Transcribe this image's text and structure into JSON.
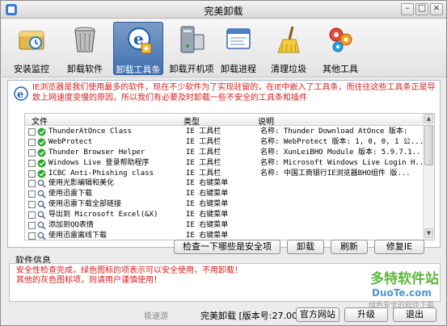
{
  "window": {
    "title": "完美卸载",
    "controls": [
      "minimize-icon",
      "maximize-icon",
      "close-icon"
    ]
  },
  "toolbar": {
    "tools": [
      {
        "label": "安装监控",
        "icon": "install-monitor-icon",
        "selected": false
      },
      {
        "label": "卸载软件",
        "icon": "trash-bin-icon",
        "selected": false
      },
      {
        "label": "卸载工具条",
        "icon": "ie-toolbar-icon",
        "selected": true
      },
      {
        "label": "卸载开机项",
        "icon": "computer-startup-icon",
        "selected": false
      },
      {
        "label": "卸载进程",
        "icon": "process-window-icon",
        "selected": false
      },
      {
        "label": "清理垃圾",
        "icon": "broom-icon",
        "selected": false
      },
      {
        "label": "其他工具",
        "icon": "gears-icon",
        "selected": false
      }
    ]
  },
  "notice": {
    "text": "IE浏览器是我们使用最多的软件，现在不少软件为了实现驻留的，在IE中嵌入了工具条，而往往这些工具条正是导致上网速度变慢的原因，所以我们有必要及时卸载一些不安全的工具条和插件"
  },
  "list": {
    "headers": {
      "file": "文件",
      "type": "类型",
      "desc": "说明"
    },
    "rows": [
      {
        "name": "ThunderAtOnce Class",
        "type": "IE 工具栏",
        "desc": "名称: Thunder Download AtOnce 版本:",
        "icon": "shield-check-icon",
        "color": "#2aa52a"
      },
      {
        "name": "WebProtect",
        "type": "IE 工具栏",
        "desc": "名称: WebProtect 版本: 1, 0, 0, 1 公...",
        "icon": "shield-check-icon",
        "color": "#2aa52a"
      },
      {
        "name": "Thunder Browser Helper",
        "type": "IE 工具栏",
        "desc": "名称: XunLeiBHO Module 版本: 5.9.7.1...",
        "icon": "shield-check-icon",
        "color": "#2aa52a"
      },
      {
        "name": "Windows Live 登录帮助程序",
        "type": "IE 工具栏",
        "desc": "名称: Microsoft Windows Live Login H...",
        "icon": "shield-check-icon",
        "color": "#2aa52a"
      },
      {
        "name": "ICBC Anti-Phishing class",
        "type": "IE 工具栏",
        "desc": "名称: 中国工商银行IE浏览器BHO组件 版...",
        "icon": "shield-check-icon",
        "color": "#2aa52a"
      },
      {
        "name": "使用光影编辑和美化",
        "type": "IE 右键菜单",
        "desc": "",
        "icon": "magnifier-icon",
        "color": "#5a6f8f"
      },
      {
        "name": "使用迅雷下载",
        "type": "IE 右键菜单",
        "desc": "",
        "icon": "magnifier-icon",
        "color": "#5a6f8f"
      },
      {
        "name": "使用迅雷下载全部链接",
        "type": "IE 右键菜单",
        "desc": "",
        "icon": "magnifier-icon",
        "color": "#5a6f8f"
      },
      {
        "name": "导出到 Microsoft Excel(&X)",
        "type": "IE 右键菜单",
        "desc": "",
        "icon": "magnifier-icon",
        "color": "#5a6f8f"
      },
      {
        "name": "添加到QQ表情",
        "type": "IE 右键菜单",
        "desc": "",
        "icon": "magnifier-icon",
        "color": "#5a6f8f"
      },
      {
        "name": "使用迅雷离线下载",
        "type": "IE 右键菜单",
        "desc": "",
        "icon": "magnifier-icon",
        "color": "#5a6f8f"
      }
    ]
  },
  "buttons": {
    "check_safe": "检查一下哪些是安全项",
    "uninstall": "卸载",
    "refresh": "刷新",
    "repair_ie": "修复IE"
  },
  "info": {
    "title": "软件信息",
    "line1": "安全性检查完成，绿色图标的项表示可以安全使用，不用卸载！",
    "line2": "其他的灰色图标项，则请用户谨慎使用！"
  },
  "status": {
    "left": "极速游",
    "text": "完美卸载 [版本号:27.00]",
    "website": "官方网站",
    "upgrade": "升级",
    "exit": "退出"
  },
  "watermark": {
    "cn": "多特软件站",
    "en": "DuoTe.com",
    "sub": "绿色安全的软件下载"
  },
  "colors": {
    "accent": "#3f6fb0",
    "warning_text": "#d62020",
    "safe_icon": "#2aa52a"
  }
}
